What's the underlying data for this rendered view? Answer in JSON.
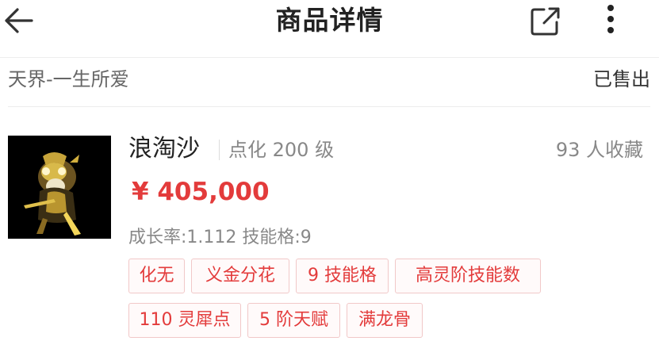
{
  "header": {
    "title": "商品详情",
    "back_icon": "arrow-left-icon",
    "share_icon": "share-icon",
    "more_icon": "more-vertical-icon"
  },
  "seller": {
    "name": "天界-一生所爱",
    "status": "已售出"
  },
  "product": {
    "name": "浪淘沙",
    "level": "点化 200 级",
    "favorites": "93 人收藏",
    "price": "¥ 405,000",
    "attributes": "成长率:1.112 技能格:9",
    "tags": [
      "化无",
      "义金分花",
      "9 技能格",
      "高灵阶技能数",
      "110 灵犀点",
      "5 阶天赋",
      "满龙骨"
    ]
  },
  "colors": {
    "accent": "#e33b3b",
    "tag_border": "#f1c8c8",
    "tag_bg": "#fffafa",
    "muted_text": "#888888"
  }
}
